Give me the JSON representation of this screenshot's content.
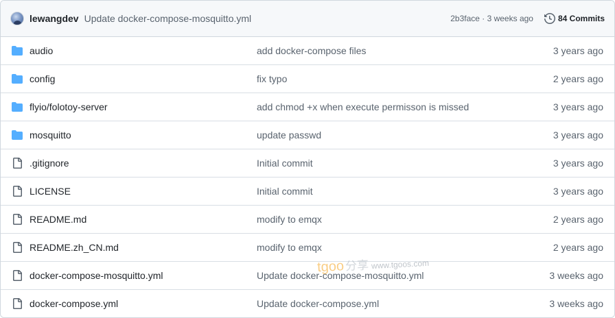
{
  "header": {
    "author": "lewangdev",
    "commit_message": "Update docker-compose-mosquitto.yml",
    "commit_meta": "2b3face · 3 weeks ago",
    "commits_label": "84 Commits",
    "avatar_icon": "avatar-icon",
    "history_icon": "history-icon"
  },
  "rows": [
    {
      "type": "folder",
      "name": "audio",
      "message": "add docker-compose files",
      "age": "3 years ago"
    },
    {
      "type": "folder",
      "name": "config",
      "message": "fix typo",
      "age": "2 years ago"
    },
    {
      "type": "folder",
      "name": "flyio/folotoy-server",
      "message": "add chmod +x when execute permisson is missed",
      "age": "3 years ago"
    },
    {
      "type": "folder",
      "name": "mosquitto",
      "message": "update passwd",
      "age": "3 years ago"
    },
    {
      "type": "file",
      "name": ".gitignore",
      "message": "Initial commit",
      "age": "3 years ago"
    },
    {
      "type": "file",
      "name": "LICENSE",
      "message": "Initial commit",
      "age": "3 years ago"
    },
    {
      "type": "file",
      "name": "README.md",
      "message": "modify to emqx",
      "age": "2 years ago"
    },
    {
      "type": "file",
      "name": "README.zh_CN.md",
      "message": "modify to emqx",
      "age": "2 years ago"
    },
    {
      "type": "file",
      "name": "docker-compose-mosquitto.yml",
      "message": "Update docker-compose-mosquitto.yml",
      "age": "3 weeks ago"
    },
    {
      "type": "file",
      "name": "docker-compose.yml",
      "message": "Update docker-compose.yml",
      "age": "3 weeks ago"
    }
  ],
  "watermark": {
    "brand": "tgoo",
    "cn": "分享",
    "url": "www.tgoos.com"
  },
  "colors": {
    "folder": "#54aeff",
    "file_icon": "#59636e",
    "border": "#d0d7de",
    "header_bg": "#f6f8fa"
  }
}
